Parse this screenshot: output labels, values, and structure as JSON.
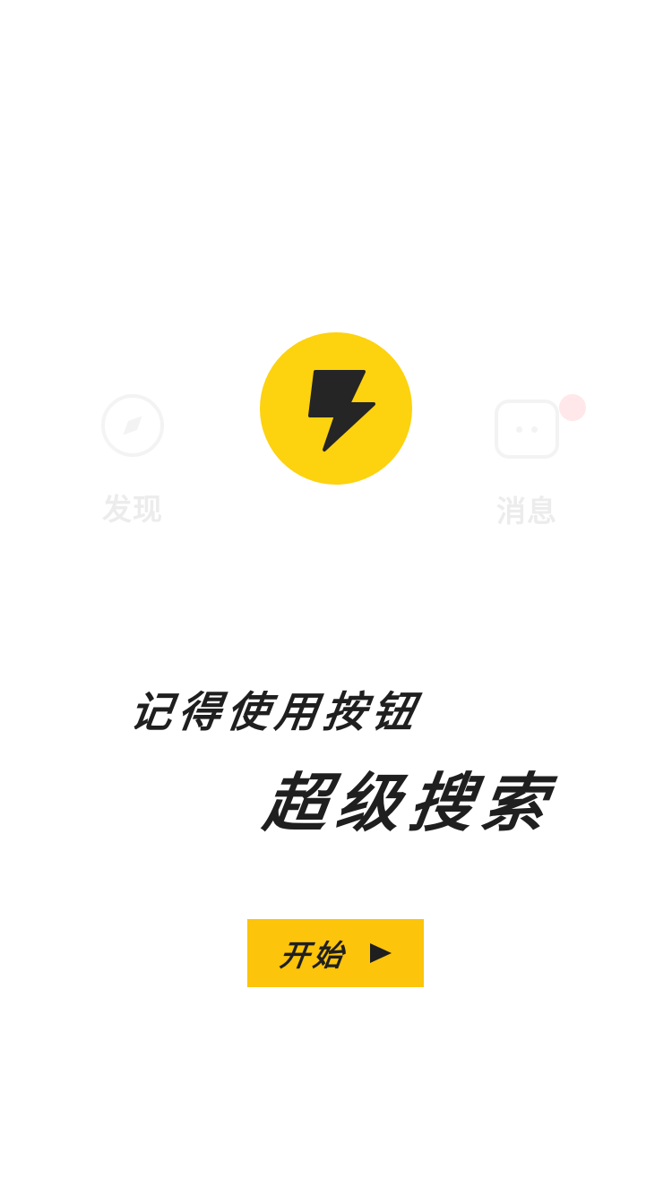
{
  "background_nav": {
    "discover": {
      "label": "发现",
      "icon": "compass-icon"
    },
    "messages": {
      "label": "消息",
      "icon": "message-icon",
      "has_notification": true
    }
  },
  "logo": {
    "icon": "lightning-bolt-icon",
    "color": "#fdd20f"
  },
  "slogan": {
    "line1": "记得使用按钮",
    "line2": "超级搜索"
  },
  "start_button": {
    "label": "开始",
    "icon": "play-icon",
    "color": "#fcc40a"
  },
  "colors": {
    "accent": "#fcc40a",
    "text": "#1f1f1f",
    "notification": "#ff5a6e"
  }
}
